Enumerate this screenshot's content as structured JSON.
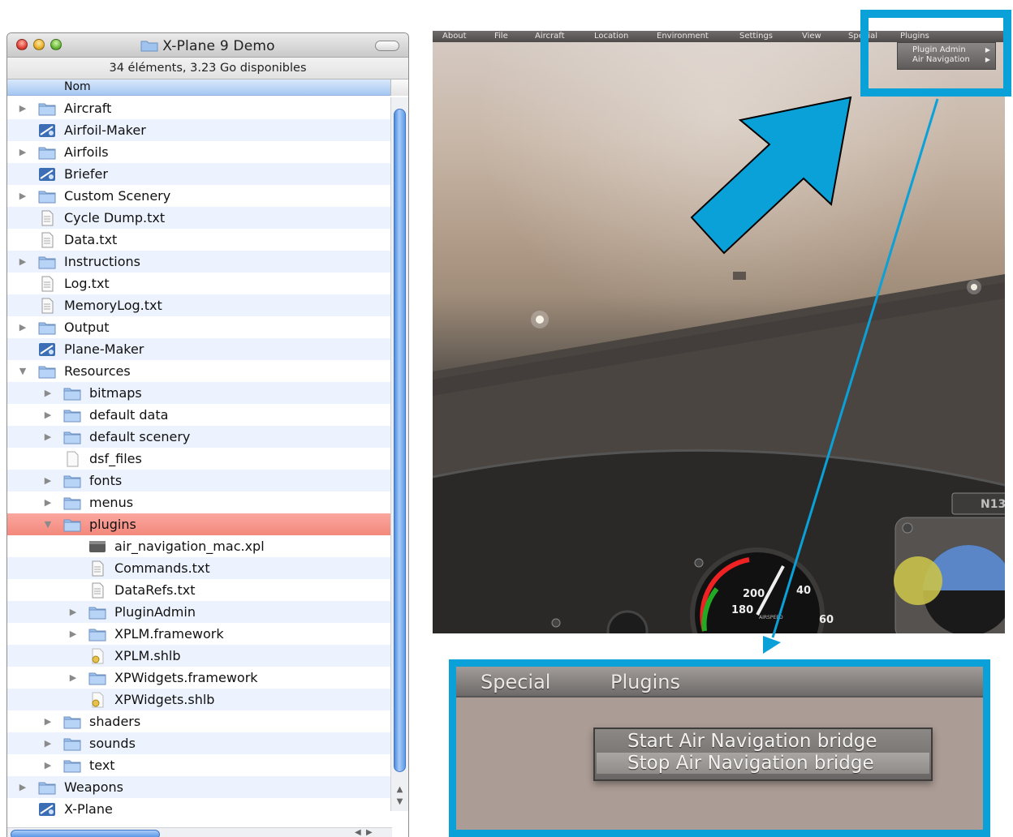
{
  "finder": {
    "title": "X-Plane 9 Demo",
    "status": "34 éléments, 3.23 Go disponibles",
    "column_header": "Nom",
    "rows": [
      {
        "label": "Aircraft",
        "kind": "folder",
        "depth": 0,
        "disclosure": "closed"
      },
      {
        "label": "Airfoil-Maker",
        "kind": "app",
        "depth": 0,
        "disclosure": "none"
      },
      {
        "label": "Airfoils",
        "kind": "folder",
        "depth": 0,
        "disclosure": "closed"
      },
      {
        "label": "Briefer",
        "kind": "app",
        "depth": 0,
        "disclosure": "none"
      },
      {
        "label": "Custom Scenery",
        "kind": "folder",
        "depth": 0,
        "disclosure": "closed"
      },
      {
        "label": "Cycle Dump.txt",
        "kind": "text",
        "depth": 0,
        "disclosure": "none"
      },
      {
        "label": "Data.txt",
        "kind": "text",
        "depth": 0,
        "disclosure": "none"
      },
      {
        "label": "Instructions",
        "kind": "folder",
        "depth": 0,
        "disclosure": "closed"
      },
      {
        "label": "Log.txt",
        "kind": "text",
        "depth": 0,
        "disclosure": "none"
      },
      {
        "label": "MemoryLog.txt",
        "kind": "text",
        "depth": 0,
        "disclosure": "none"
      },
      {
        "label": "Output",
        "kind": "folder",
        "depth": 0,
        "disclosure": "closed"
      },
      {
        "label": "Plane-Maker",
        "kind": "app",
        "depth": 0,
        "disclosure": "none"
      },
      {
        "label": "Resources",
        "kind": "folder",
        "depth": 0,
        "disclosure": "open"
      },
      {
        "label": "bitmaps",
        "kind": "folder",
        "depth": 1,
        "disclosure": "closed"
      },
      {
        "label": "default data",
        "kind": "folder",
        "depth": 1,
        "disclosure": "closed"
      },
      {
        "label": "default scenery",
        "kind": "folder",
        "depth": 1,
        "disclosure": "closed"
      },
      {
        "label": "dsf_files",
        "kind": "blank",
        "depth": 1,
        "disclosure": "none"
      },
      {
        "label": "fonts",
        "kind": "folder",
        "depth": 1,
        "disclosure": "closed"
      },
      {
        "label": "menus",
        "kind": "folder",
        "depth": 1,
        "disclosure": "closed"
      },
      {
        "label": "plugins",
        "kind": "folder",
        "depth": 1,
        "disclosure": "open",
        "selected": true
      },
      {
        "label": "air_navigation_mac.xpl",
        "kind": "binary",
        "depth": 2,
        "disclosure": "none"
      },
      {
        "label": "Commands.txt",
        "kind": "text",
        "depth": 2,
        "disclosure": "none"
      },
      {
        "label": "DataRefs.txt",
        "kind": "text",
        "depth": 2,
        "disclosure": "none"
      },
      {
        "label": "PluginAdmin",
        "kind": "folder",
        "depth": 2,
        "disclosure": "closed"
      },
      {
        "label": "XPLM.framework",
        "kind": "folder",
        "depth": 2,
        "disclosure": "closed"
      },
      {
        "label": "XPLM.shlb",
        "kind": "lib",
        "depth": 2,
        "disclosure": "none"
      },
      {
        "label": "XPWidgets.framework",
        "kind": "folder",
        "depth": 2,
        "disclosure": "closed"
      },
      {
        "label": "XPWidgets.shlb",
        "kind": "lib",
        "depth": 2,
        "disclosure": "none"
      },
      {
        "label": "shaders",
        "kind": "folder",
        "depth": 1,
        "disclosure": "closed"
      },
      {
        "label": "sounds",
        "kind": "folder",
        "depth": 1,
        "disclosure": "closed"
      },
      {
        "label": "text",
        "kind": "folder",
        "depth": 1,
        "disclosure": "closed"
      },
      {
        "label": "Weapons",
        "kind": "folder",
        "depth": 0,
        "disclosure": "closed"
      },
      {
        "label": "X-Plane",
        "kind": "app",
        "depth": 0,
        "disclosure": "none"
      }
    ]
  },
  "sim": {
    "menu": [
      "About",
      "File",
      "Aircraft",
      "Location",
      "Environment",
      "Settings",
      "View",
      "Special",
      "Plugins"
    ],
    "plugins_menu_items": [
      "Plugin Admin",
      "Air Navigation"
    ],
    "tail_number": "N13",
    "airspeed_labels": [
      "200",
      "180",
      "40",
      "60"
    ],
    "airspeed_caption": "AIRSPEED"
  },
  "zoom": {
    "menu": [
      "Special",
      "Plugins"
    ],
    "items": [
      "Start Air Navigation bridge",
      "Stop Air Navigation bridge"
    ]
  },
  "colors": {
    "highlight": "#0aa0d8",
    "selection": "#f48b80",
    "folder_blue": "#9fc2ee"
  }
}
